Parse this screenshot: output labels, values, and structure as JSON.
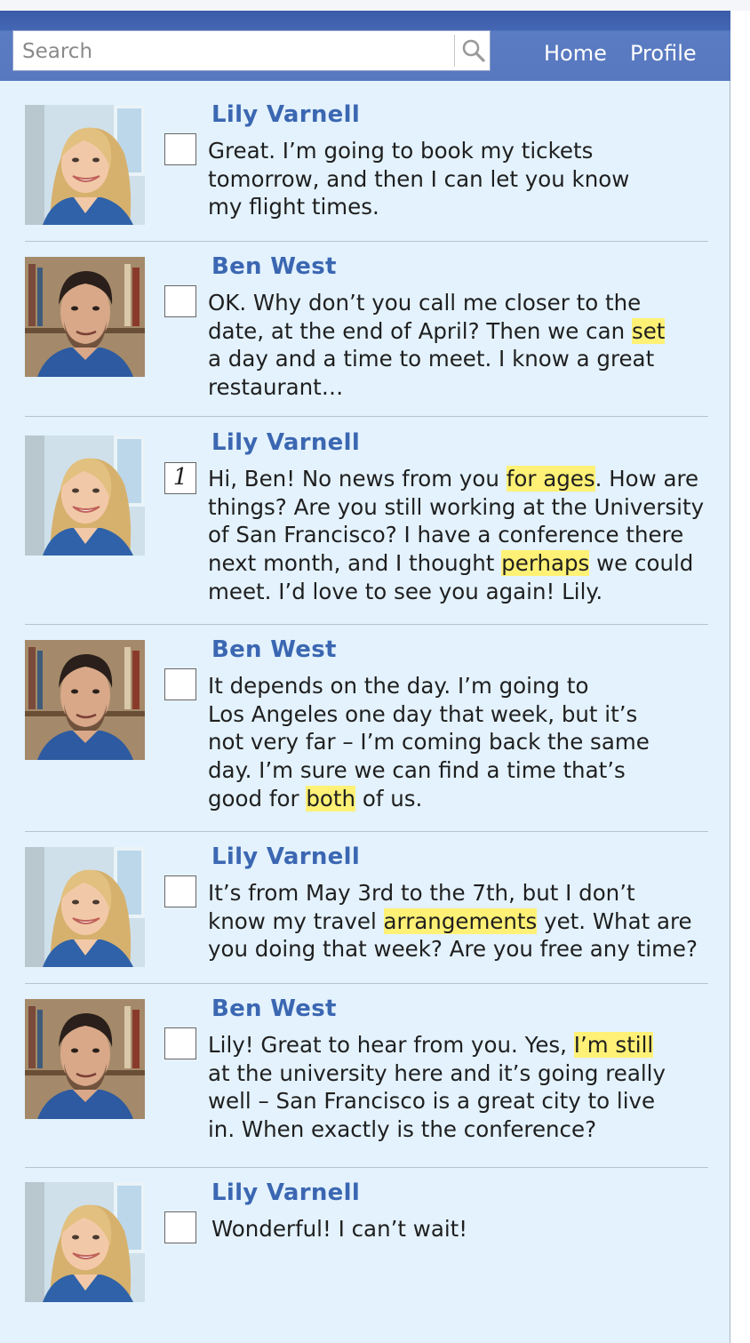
{
  "search": {
    "placeholder": "Search"
  },
  "nav": {
    "home": "Home",
    "profile": "Profile"
  },
  "messages": [
    {
      "author": "Lily Varnell",
      "avatar": "lily",
      "checkbox": "",
      "lines": [
        [
          "Great. I’m going to book my tickets"
        ],
        [
          "tomorrow, and then I can let you know"
        ],
        [
          "my flight times."
        ]
      ]
    },
    {
      "author": "Ben West",
      "avatar": "ben",
      "checkbox": "",
      "lines": [
        [
          "OK. Why don’t you call me closer to the"
        ],
        [
          "date, at the end of April? Then we can ",
          {
            "h": "set"
          }
        ],
        [
          "a day and a time to meet. I know a great"
        ],
        [
          "restaurant…"
        ]
      ]
    },
    {
      "author": "Lily Varnell",
      "avatar": "lily",
      "checkbox": "1",
      "lines": [
        [
          "Hi, Ben! No news from you ",
          {
            "h": "for ages"
          },
          ". How are"
        ],
        [
          "things? Are you still working at the University"
        ],
        [
          "of San Francisco? I have a conference there"
        ],
        [
          "next month, and I thought ",
          {
            "h": "perhaps"
          },
          " we could"
        ],
        [
          "meet. I’d love to see you again! Lily."
        ]
      ]
    },
    {
      "author": "Ben West",
      "avatar": "ben",
      "checkbox": "",
      "lines": [
        [
          "It depends on the day. I’m going to"
        ],
        [
          "Los Angeles one day that week, but it’s"
        ],
        [
          "not very far – I’m coming back the same"
        ],
        [
          "day. I’m sure we can find a time that’s"
        ],
        [
          "good for ",
          {
            "h": "both"
          },
          " of us."
        ]
      ]
    },
    {
      "author": "Lily Varnell",
      "avatar": "lily",
      "checkbox": "",
      "lines": [
        [
          "It’s from May 3rd to the 7th, but I don’t"
        ],
        [
          "know my travel ",
          {
            "h": "arrangements"
          },
          " yet. What are"
        ],
        [
          "you doing that week? Are you free any time?"
        ]
      ]
    },
    {
      "author": "Ben West",
      "avatar": "ben",
      "checkbox": "",
      "lines": [
        [
          "Lily! Great to hear from you. Yes, ",
          {
            "h": "I’m still"
          }
        ],
        [
          "at the university here and it’s going really"
        ],
        [
          "well – San Francisco is a great city to live"
        ],
        [
          "in. When exactly is the conference?"
        ]
      ]
    },
    {
      "author": "Lily Varnell",
      "avatar": "lily",
      "checkbox": "",
      "lines": [
        [
          "Wonderful! I can’t wait!"
        ]
      ]
    }
  ]
}
